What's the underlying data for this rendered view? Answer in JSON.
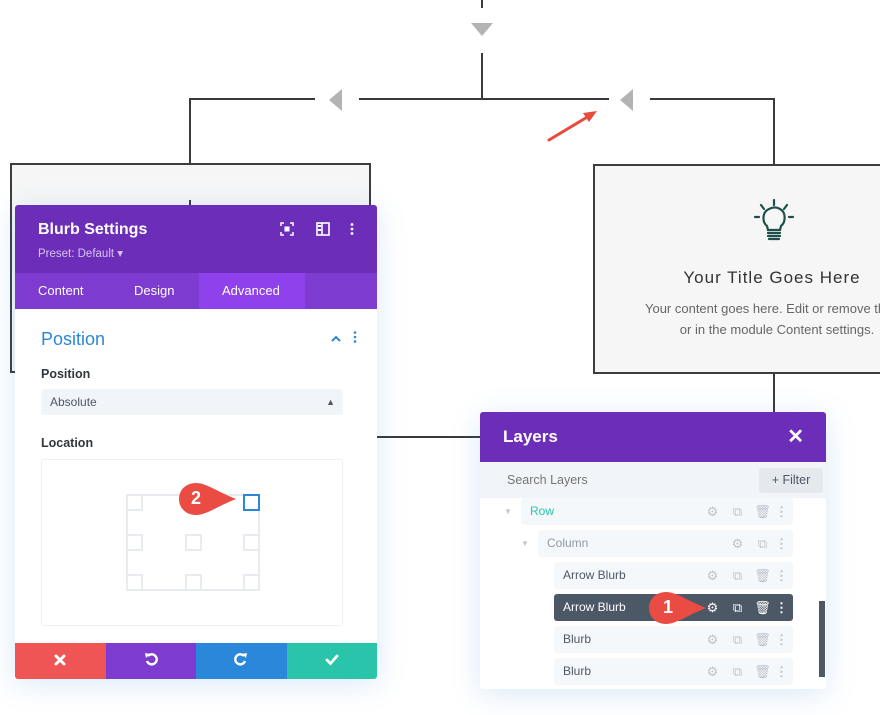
{
  "canvas": {
    "blurb": {
      "title": "Your Title Goes Here",
      "text_line1": "Your content goes here. Edit or remove this te",
      "text_line2": "or in the module Content settings.",
      "icon": "lightbulb-icon",
      "icon_color": "#1f4f4a"
    }
  },
  "settings_panel": {
    "title": "Blurb Settings",
    "preset": "Preset: Default ▾",
    "header_icons": [
      "focus-icon",
      "split-view-icon",
      "more-options-icon"
    ],
    "tabs": [
      {
        "label": "Content",
        "active": false
      },
      {
        "label": "Design",
        "active": false
      },
      {
        "label": "Advanced",
        "active": true
      }
    ],
    "group": {
      "title": "Position",
      "expanded": true
    },
    "position_field": {
      "label": "Position",
      "value": "Absolute"
    },
    "location_field": {
      "label": "Location",
      "selected": "top-right"
    },
    "footer": {
      "cancel": "✖",
      "undo": "↺",
      "redo": "↻",
      "save": "✔",
      "colors": {
        "cancel": "#ef5555",
        "undo": "#7e3bd0",
        "redo": "#2b87da",
        "save": "#29c4a9"
      }
    }
  },
  "layers_panel": {
    "title": "Layers",
    "close": "✕",
    "search_placeholder": "Search Layers",
    "filter_label": "+ Filter",
    "items": [
      {
        "label": "Row",
        "level": 0,
        "selected": false
      },
      {
        "label": "Column",
        "level": 1,
        "selected": false
      },
      {
        "label": "Arrow Blurb",
        "level": 2,
        "selected": false
      },
      {
        "label": "Arrow Blurb",
        "level": 2,
        "selected": true
      },
      {
        "label": "Blurb",
        "level": 2,
        "selected": false
      },
      {
        "label": "Blurb",
        "level": 2,
        "selected": false
      }
    ]
  },
  "annotations": {
    "badge1": "1",
    "badge2": "2",
    "badge_color": "#ea4c43"
  },
  "colors": {
    "purple_header": "#6c2eb9",
    "purple_tabs": "#7d3bcf",
    "accent_blue": "#2b87da",
    "teal": "#29c4a9"
  }
}
